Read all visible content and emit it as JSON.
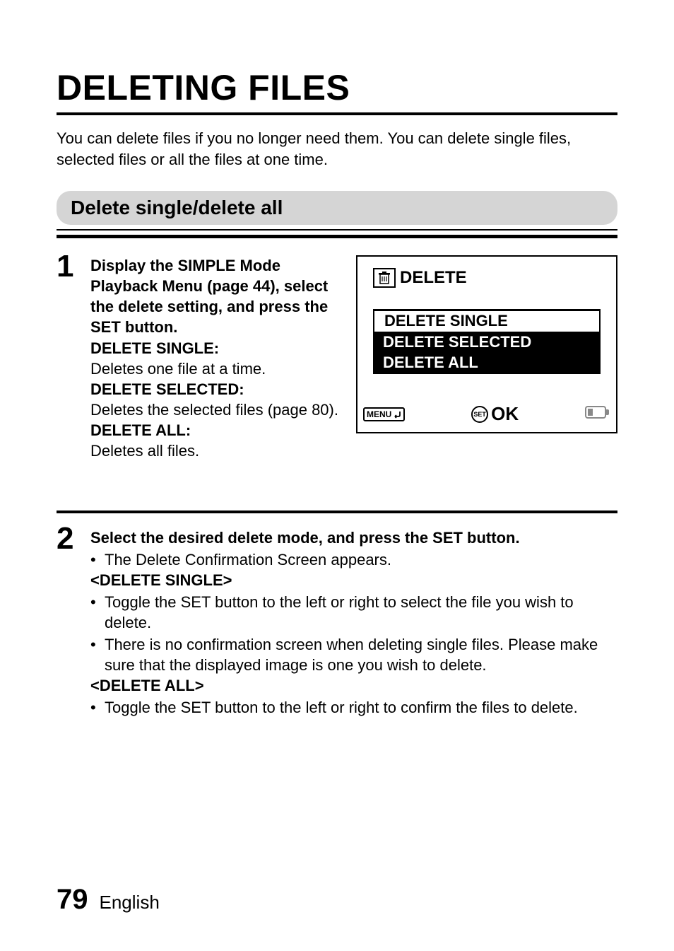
{
  "page": {
    "title": "DELETING FILES",
    "intro": "You can delete files if you no longer need them. You can delete single files, selected files or all the files at one time.",
    "section_heading": "Delete single/delete all",
    "page_number": "79",
    "language": "English"
  },
  "step1": {
    "number": "1",
    "instruction_bold": "Display the SIMPLE Mode Playback Menu (page 44), select the delete setting, and press the SET button.",
    "opt1_title": "DELETE SINGLE:",
    "opt1_desc": "Deletes one file at a time.",
    "opt2_title": "DELETE SELECTED:",
    "opt2_desc": "Deletes the selected files (page 80).",
    "opt3_title": "DELETE ALL:",
    "opt3_desc": "Deletes all files."
  },
  "screen": {
    "title": "DELETE",
    "menu_items": [
      "DELETE SINGLE",
      "DELETE SELECTED",
      "DELETE ALL"
    ],
    "menu_label": "MENU",
    "set_label": "SET",
    "ok_label": "OK"
  },
  "step2": {
    "number": "2",
    "instruction_bold": "Select the desired delete mode, and press the SET button.",
    "bullet1": "The Delete Confirmation Screen appears.",
    "sub1_title": "<DELETE SINGLE>",
    "sub1_b1": "Toggle the SET button to the left or right to select the file you wish to delete.",
    "sub1_b2": "There is no confirmation screen when deleting single files. Please make sure that the displayed image is one you wish to delete.",
    "sub2_title": "<DELETE ALL>",
    "sub2_b1": "Toggle the SET button to the left or right to confirm the files to delete."
  }
}
